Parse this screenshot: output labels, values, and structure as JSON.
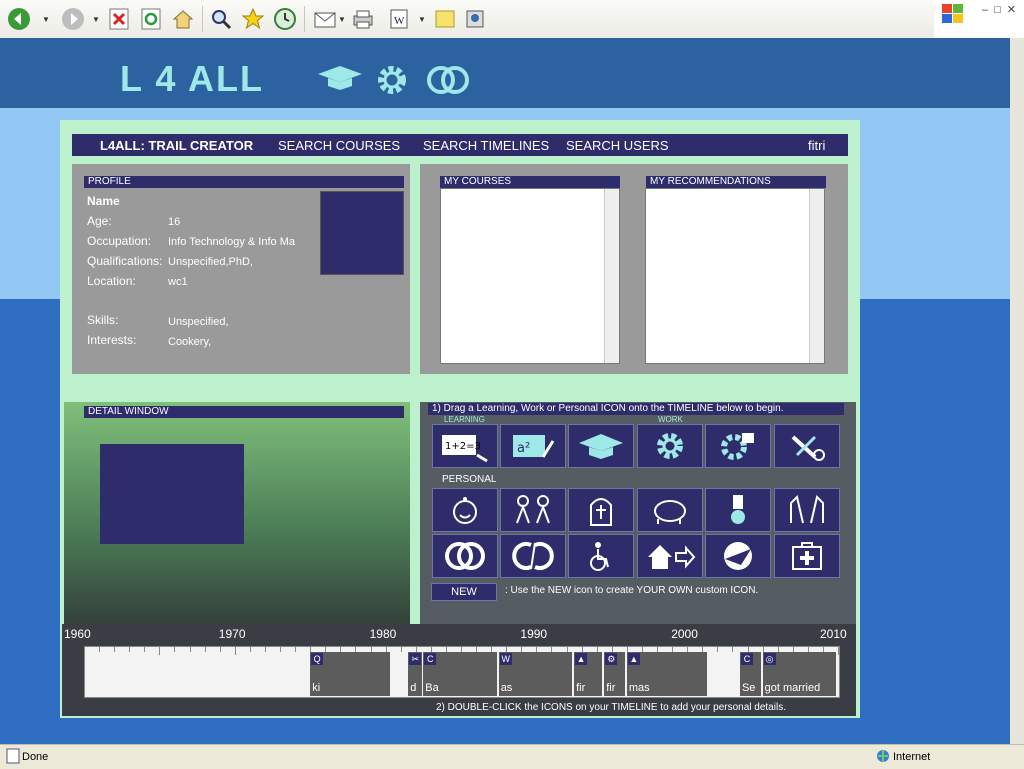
{
  "browser": {
    "toolbar_icons": [
      "back-icon",
      "forward-icon",
      "stop-icon",
      "refresh-icon",
      "home-icon",
      "search-icon",
      "favorites-icon",
      "history-icon",
      "mail-icon",
      "print-icon",
      "edit-icon",
      "discuss-icon",
      "messenger-icon"
    ],
    "status_text": "Done",
    "zone_text": "Internet"
  },
  "header": {
    "logo": "L 4 ALL",
    "icons": [
      "graduation-cap-icon",
      "gear-icon",
      "rings-icon"
    ]
  },
  "nav": {
    "title": "L4ALL: TRAIL CREATOR",
    "search_courses": "SEARCH COURSES",
    "search_timelines": "SEARCH TIMELINES",
    "search_users": "SEARCH USERS",
    "user": "fitri"
  },
  "profile": {
    "title": "PROFILE",
    "name_label": "Name",
    "age_label": "Age:",
    "age": "16",
    "occupation_label": "Occupation:",
    "occupation": "Info Technology & Info Ma",
    "qualifications_label": "Qualifications:",
    "qualifications": "Unspecified,PhD,",
    "location_label": "Location:",
    "location": "wc1",
    "skills_label": "Skills:",
    "skills": "Unspecified,",
    "interests_label": "Interests:",
    "interests": "Cookery,"
  },
  "courses": {
    "title": "MY COURSES"
  },
  "recommendations": {
    "title": "MY RECOMMENDATIONS"
  },
  "detail": {
    "title": "DETAIL WINDOW"
  },
  "icons_panel": {
    "instruction1": "1) Drag a Learning, Work or Personal ICON onto the TIMELINE below to begin.",
    "learning_label": "LEARNING",
    "work_label": "WORK",
    "personal_label": "PERSONAL",
    "new_label": "NEW",
    "new_instruction": ": Use the NEW icon to create YOUR OWN custom ICON.",
    "instruction2": "2) DOUBLE-CLICK the ICONS on your TIMELINE to add your personal details."
  },
  "timeline": {
    "years": [
      "1960",
      "1970",
      "1980",
      "1990",
      "2000",
      "2010"
    ],
    "events": [
      {
        "year": 1975,
        "text": "ki",
        "icon": "Q"
      },
      {
        "year": 1981.5,
        "text": "d",
        "icon": "✂"
      },
      {
        "year": 1982.5,
        "text": "Ba",
        "icon": "C"
      },
      {
        "year": 1987.5,
        "text": "as",
        "icon": "W"
      },
      {
        "year": 1992.5,
        "text": "fir",
        "icon": "▲"
      },
      {
        "year": 1994.5,
        "text": "fir",
        "icon": "⚙"
      },
      {
        "year": 1996,
        "text": "mas",
        "icon": "▲"
      },
      {
        "year": 2003.5,
        "text": "Se",
        "icon": "C"
      },
      {
        "year": 2005,
        "text": "got married",
        "icon": "◎"
      }
    ]
  }
}
